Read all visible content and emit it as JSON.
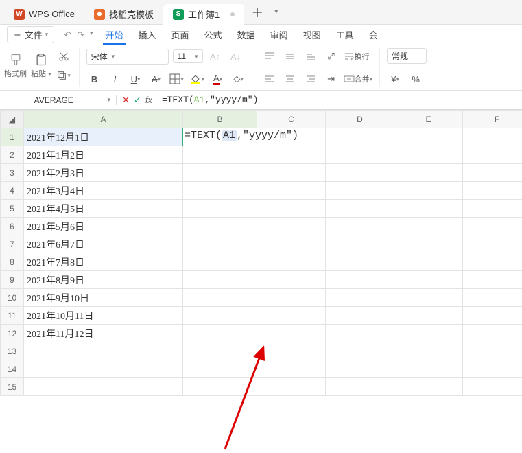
{
  "top_tabs": {
    "tab1": "WPS Office",
    "tab2": "找稻壳模板",
    "tab3": "工作簿1"
  },
  "menu": {
    "file": "三 文件",
    "items": [
      "开始",
      "插入",
      "页面",
      "公式",
      "数据",
      "审阅",
      "视图",
      "工具",
      "会"
    ]
  },
  "ribbon": {
    "format_brush": "格式刷",
    "paste": "粘贴",
    "font_name": "宋体",
    "font_size": "11",
    "wrap": "换行",
    "merge": "合并",
    "number_format": "常规",
    "currency": "¥",
    "percent": "%"
  },
  "formula_bar": {
    "name_box": "AVERAGE",
    "fx": "fx",
    "prefix": "=TEXT(",
    "ref": "A1",
    "suffix": ",\"yyyy/m\")"
  },
  "cell_editing": {
    "prefix": "=TEXT(",
    "ref": "A1",
    "mid": ",",
    "str": "\"yyyy/m\")"
  },
  "columns": [
    "A",
    "B",
    "C",
    "D",
    "E",
    "F"
  ],
  "data": {
    "A1": "2021年12月1日",
    "A2": "2021年1月2日",
    "A3": "2021年2月3日",
    "A4": "2021年3月4日",
    "A5": "2021年4月5日",
    "A6": "2021年5月6日",
    "A7": "2021年6月7日",
    "A8": "2021年7月8日",
    "A9": "2021年8月9日",
    "A10": "2021年9月10日",
    "A11": "2021年10月11日",
    "A12": "2021年11月12日"
  },
  "visible_rows": 15
}
